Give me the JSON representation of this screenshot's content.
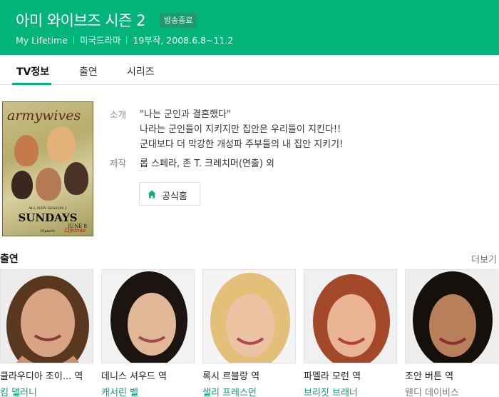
{
  "header": {
    "title": "아미 와이브즈 시즌 2",
    "badge": "방송종료",
    "channel": "My Lifetime",
    "genre": "미국드라마",
    "info": "19부작, 2008.6.8~11.2"
  },
  "tabs": [
    {
      "label": "TV정보"
    },
    {
      "label": "출연"
    },
    {
      "label": "시리즈"
    }
  ],
  "poster": {
    "logo": "armywives",
    "line1": "ALL NEW SEASON 2",
    "line2": "SUNDAYS",
    "line3": "JUNE 8",
    "line4": "10pm/9c",
    "channel": "Lifetime"
  },
  "info": {
    "intro_label": "소개",
    "intro_lines": [
      "\"나는 군인과 결혼했다\"",
      "나라는 군인들이 지키지만 집안은 우리들이 지킨다!!",
      "군대보다 더 막강한 개성파 주부들의 내 집안 지키기!"
    ],
    "staff_label": "제작",
    "staff_text": "롭 스페라, 존 T. 크레치머(연출) 외",
    "home_button": "공식홈"
  },
  "cast": {
    "title": "출연",
    "more": "더보기",
    "members": [
      {
        "role": "클라우디아 조이... 역",
        "actor": "킴 델러니"
      },
      {
        "role": "데니스 셔우드 역",
        "actor": "캐서린 벨"
      },
      {
        "role": "록시 르블랑 역",
        "actor": "샐리 프레스먼"
      },
      {
        "role": "파멜라 모런 역",
        "actor": "브리짓 브래너"
      },
      {
        "role": "조안 버튼 역",
        "actor": "웬디 데이비스"
      }
    ]
  },
  "colors": {
    "accent": "#03b47a",
    "link": "#03a06b"
  }
}
